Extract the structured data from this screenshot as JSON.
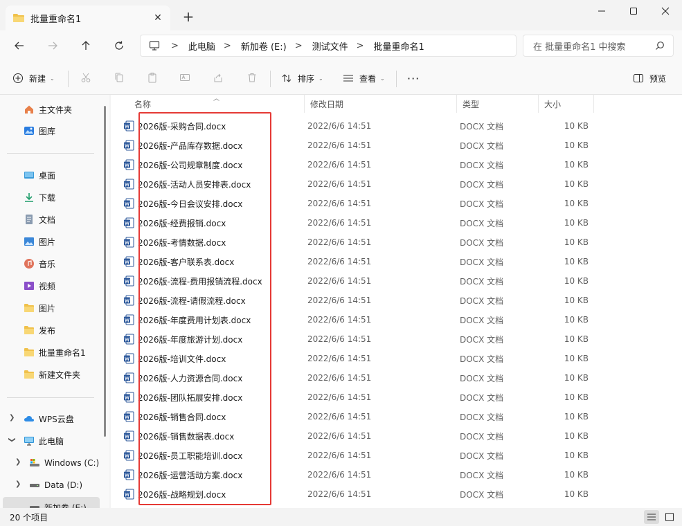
{
  "window": {
    "tab_title": "批量重命名1",
    "new_tab_symbol": "+",
    "close_symbol": "✕",
    "minimize_symbol": "—",
    "maximize_symbol": "☐",
    "window_close_symbol": "✕"
  },
  "address": {
    "breadcrumbs": [
      "此电脑",
      "新加卷 (E:)",
      "测试文件",
      "批量重命名1"
    ],
    "separator": ">",
    "search_placeholder": "在 批量重命名1 中搜索"
  },
  "toolbar": {
    "new_label": "新建",
    "sort_label": "排序",
    "view_label": "查看",
    "more_label": "···",
    "preview_label": "预览"
  },
  "sidebar": {
    "quick": [
      {
        "label": "主文件夹",
        "icon": "home-icon"
      },
      {
        "label": "图库",
        "icon": "gallery-icon"
      }
    ],
    "pinned": [
      {
        "label": "桌面",
        "icon": "desktop-icon",
        "pinned": true
      },
      {
        "label": "下载",
        "icon": "download-icon",
        "pinned": true
      },
      {
        "label": "文档",
        "icon": "document-icon",
        "pinned": true
      },
      {
        "label": "图片",
        "icon": "pictures-icon",
        "pinned": true
      },
      {
        "label": "音乐",
        "icon": "music-icon",
        "pinned": true
      },
      {
        "label": "视频",
        "icon": "video-icon",
        "pinned": true
      },
      {
        "label": "图片",
        "icon": "folder-icon",
        "pinned": false
      },
      {
        "label": "发布",
        "icon": "folder-icon",
        "pinned": false
      },
      {
        "label": "批量重命名1",
        "icon": "folder-icon",
        "pinned": false
      },
      {
        "label": "新建文件夹",
        "icon": "folder-icon",
        "pinned": false
      }
    ],
    "tree": [
      {
        "label": "WPS云盘",
        "icon": "cloud-icon",
        "expanded": false
      },
      {
        "label": "此电脑",
        "icon": "pc-icon",
        "expanded": true
      },
      {
        "label": "Windows (C:)",
        "icon": "drive-c-icon",
        "expanded": false
      },
      {
        "label": "Data (D:)",
        "icon": "drive-icon",
        "expanded": false
      },
      {
        "label": "新加卷 (E:)",
        "icon": "drive-icon",
        "expanded": false
      }
    ]
  },
  "columns": {
    "name": "名称",
    "date": "修改日期",
    "type": "类型",
    "size": "大小"
  },
  "files": [
    {
      "name": "2026版-采购合同.docx",
      "date": "2022/6/6 14:51",
      "type": "DOCX 文档",
      "size": "10 KB"
    },
    {
      "name": "2026版-产品库存数据.docx",
      "date": "2022/6/6 14:51",
      "type": "DOCX 文档",
      "size": "10 KB"
    },
    {
      "name": "2026版-公司规章制度.docx",
      "date": "2022/6/6 14:51",
      "type": "DOCX 文档",
      "size": "10 KB"
    },
    {
      "name": "2026版-活动人员安排表.docx",
      "date": "2022/6/6 14:51",
      "type": "DOCX 文档",
      "size": "10 KB"
    },
    {
      "name": "2026版-今日会议安排.docx",
      "date": "2022/6/6 14:51",
      "type": "DOCX 文档",
      "size": "10 KB"
    },
    {
      "name": "2026版-经费报销.docx",
      "date": "2022/6/6 14:51",
      "type": "DOCX 文档",
      "size": "10 KB"
    },
    {
      "name": "2026版-考情数据.docx",
      "date": "2022/6/6 14:51",
      "type": "DOCX 文档",
      "size": "10 KB"
    },
    {
      "name": "2026版-客户联系表.docx",
      "date": "2022/6/6 14:51",
      "type": "DOCX 文档",
      "size": "10 KB"
    },
    {
      "name": "2026版-流程-费用报销流程.docx",
      "date": "2022/6/6 14:51",
      "type": "DOCX 文档",
      "size": "10 KB"
    },
    {
      "name": "2026版-流程-请假流程.docx",
      "date": "2022/6/6 14:51",
      "type": "DOCX 文档",
      "size": "10 KB"
    },
    {
      "name": "2026版-年度费用计划表.docx",
      "date": "2022/6/6 14:51",
      "type": "DOCX 文档",
      "size": "10 KB"
    },
    {
      "name": "2026版-年度旅游计划.docx",
      "date": "2022/6/6 14:51",
      "type": "DOCX 文档",
      "size": "10 KB"
    },
    {
      "name": "2026版-培训文件.docx",
      "date": "2022/6/6 14:51",
      "type": "DOCX 文档",
      "size": "10 KB"
    },
    {
      "name": "2026版-人力资源合同.docx",
      "date": "2022/6/6 14:51",
      "type": "DOCX 文档",
      "size": "10 KB"
    },
    {
      "name": "2026版-团队拓展安排.docx",
      "date": "2022/6/6 14:51",
      "type": "DOCX 文档",
      "size": "10 KB"
    },
    {
      "name": "2026版-销售合同.docx",
      "date": "2022/6/6 14:51",
      "type": "DOCX 文档",
      "size": "10 KB"
    },
    {
      "name": "2026版-销售数据表.docx",
      "date": "2022/6/6 14:51",
      "type": "DOCX 文档",
      "size": "10 KB"
    },
    {
      "name": "2026版-员工职能培训.docx",
      "date": "2022/6/6 14:51",
      "type": "DOCX 文档",
      "size": "10 KB"
    },
    {
      "name": "2026版-运营活动方案.docx",
      "date": "2022/6/6 14:51",
      "type": "DOCX 文档",
      "size": "10 KB"
    },
    {
      "name": "2026版-战略规划.docx",
      "date": "2022/6/6 14:51",
      "type": "DOCX 文档",
      "size": "10 KB"
    }
  ],
  "status": {
    "item_count": "20 个项目"
  },
  "colors": {
    "accent": "#0067c0",
    "highlight_box": "#e53935",
    "folder": "#f0c14b",
    "word": "#2b579a"
  }
}
